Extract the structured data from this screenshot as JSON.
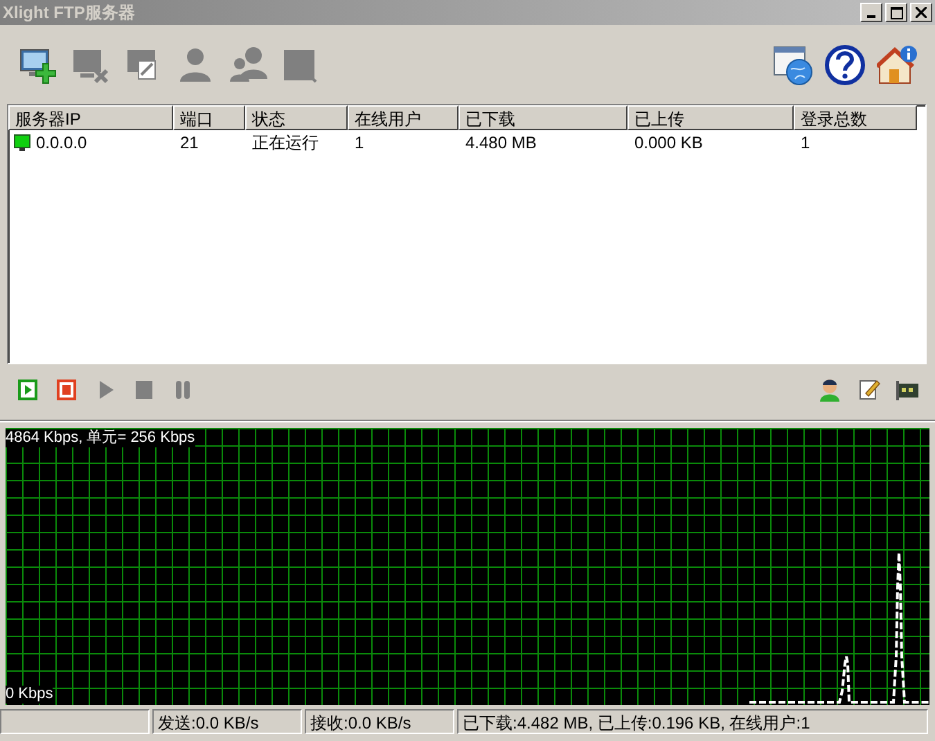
{
  "window": {
    "title": "Xlight FTP服务器"
  },
  "toolbar": {
    "left": [
      {
        "kind": "add-server",
        "disabled": false
      },
      {
        "kind": "remove-server",
        "disabled": true
      },
      {
        "kind": "edit-server",
        "disabled": true
      },
      {
        "kind": "user",
        "disabled": true
      },
      {
        "kind": "group",
        "disabled": true
      },
      {
        "kind": "log",
        "disabled": true
      }
    ],
    "right": [
      {
        "kind": "web",
        "disabled": false
      },
      {
        "kind": "help",
        "disabled": false
      },
      {
        "kind": "about",
        "disabled": false
      }
    ]
  },
  "table": {
    "columns": [
      "服务器IP",
      "端口",
      "状态",
      "在线用户",
      "已下载",
      "已上传",
      "登录总数"
    ],
    "rows": [
      {
        "running": true,
        "cells": [
          "0.0.0.0",
          "21",
          "正在运行",
          "1",
          "4.480 MB",
          "0.000 KB",
          "1"
        ]
      }
    ]
  },
  "controls": {
    "left": [
      {
        "kind": "start",
        "disabled": false
      },
      {
        "kind": "stop",
        "disabled": false
      },
      {
        "kind": "play",
        "disabled": true
      },
      {
        "kind": "halt",
        "disabled": true
      },
      {
        "kind": "pause",
        "disabled": true
      }
    ],
    "right": [
      {
        "kind": "person",
        "disabled": false
      },
      {
        "kind": "note",
        "disabled": false
      },
      {
        "kind": "card",
        "disabled": false
      }
    ]
  },
  "graph": {
    "scale_label": "4864 Kbps, 单元= 256 Kbps",
    "zero_label": "0 Kbps"
  },
  "status_bar": [
    "发送:0.0 KB/s",
    "接收:0.0 KB/s",
    "已下载:4.482 MB, 已上传:0.196 KB, 在线用户:1"
  ]
}
